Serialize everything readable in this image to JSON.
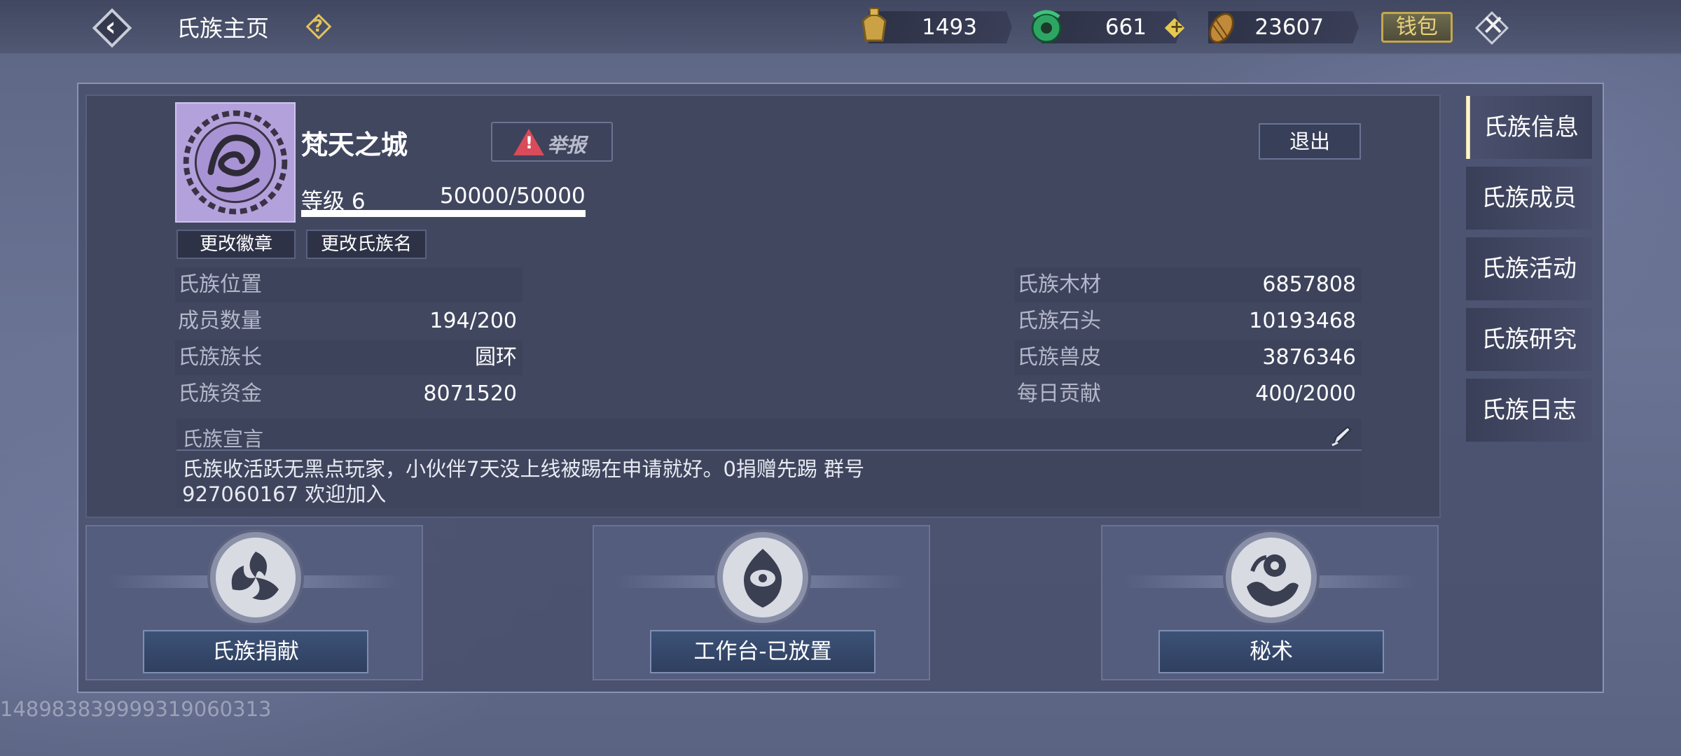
{
  "header": {
    "title": "氏族主页",
    "resources": [
      {
        "name": "gold-bell",
        "value": "1493"
      },
      {
        "name": "jade",
        "value": "661"
      },
      {
        "name": "shell",
        "value": "23607"
      }
    ],
    "wallet_label": "钱包"
  },
  "clan": {
    "name": "梵天之城",
    "report_label": "举报",
    "level": "等级 6",
    "exp": "50000/50000",
    "exp_fraction": 1.0,
    "logout_label": "退出",
    "change_badge_label": "更改徽章",
    "change_name_label": "更改氏族名"
  },
  "stats_left": [
    {
      "label": "氏族位置",
      "value": ""
    },
    {
      "label": "成员数量",
      "value": "194/200"
    },
    {
      "label": "氏族族长",
      "value": "圆环"
    },
    {
      "label": "氏族资金",
      "value": "8071520"
    }
  ],
  "stats_right": [
    {
      "label": "氏族木材",
      "value": "6857808"
    },
    {
      "label": "氏族石头",
      "value": "10193468"
    },
    {
      "label": "氏族兽皮",
      "value": "3876346"
    },
    {
      "label": "每日贡献",
      "value": "400/2000"
    }
  ],
  "declaration": {
    "label": "氏族宣言",
    "text": "氏族收活跃无黑点玩家，小伙伴7天没上线被踢在申请就好。0捐赠先踢 群号\n927060167  欢迎加入"
  },
  "features": [
    {
      "label": "氏族捐献",
      "icon": "swirl-emblem-icon"
    },
    {
      "label": "工作台-已放置",
      "icon": "eye-emblem-icon"
    },
    {
      "label": "秘术",
      "icon": "moon-wave-emblem-icon"
    }
  ],
  "tabs": [
    {
      "label": "氏族信息",
      "active": true
    },
    {
      "label": "氏族成员",
      "active": false
    },
    {
      "label": "氏族活动",
      "active": false
    },
    {
      "label": "氏族研究",
      "active": false
    },
    {
      "label": "氏族日志",
      "active": false
    }
  ],
  "footer_id": "1489838399993190603​13"
}
